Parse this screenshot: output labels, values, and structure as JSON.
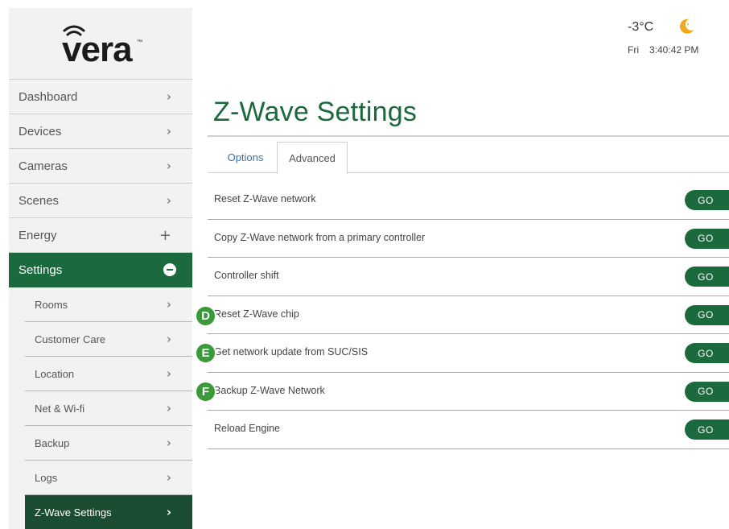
{
  "logo": {
    "text": "vera"
  },
  "sidebar": {
    "items": [
      {
        "label": "Dashboard",
        "icon": "chevron-right-icon",
        "glyph": "›"
      },
      {
        "label": "Devices",
        "icon": "chevron-right-icon",
        "glyph": "›"
      },
      {
        "label": "Cameras",
        "icon": "chevron-right-icon",
        "glyph": "›"
      },
      {
        "label": "Scenes",
        "icon": "chevron-right-icon",
        "glyph": "›"
      },
      {
        "label": "Energy",
        "icon": "plus-icon",
        "glyph": "+"
      },
      {
        "label": "Settings",
        "icon": "minus-icon",
        "expanded": true
      }
    ],
    "subitems": [
      {
        "label": "Rooms",
        "glyph": "›"
      },
      {
        "label": "Customer Care",
        "glyph": "›"
      },
      {
        "label": "Location",
        "glyph": "›"
      },
      {
        "label": "Net & Wi-fi",
        "glyph": "›"
      },
      {
        "label": "Backup",
        "glyph": "›"
      },
      {
        "label": "Logs",
        "glyph": "›"
      },
      {
        "label": "Z-Wave Settings",
        "glyph": "›",
        "active": true
      }
    ]
  },
  "header": {
    "temperature": "-3°C",
    "weather_icon": "moon-icon",
    "day": "Fri",
    "time": "3:40:42 PM"
  },
  "main": {
    "title": "Z-Wave Settings",
    "tabs": [
      {
        "label": "Options",
        "active": false
      },
      {
        "label": "Advanced",
        "active": true
      }
    ],
    "rows": [
      {
        "label": "Reset Z-Wave network",
        "button": "GO"
      },
      {
        "label": "Copy Z-Wave network from a primary controller",
        "button": "GO"
      },
      {
        "label": "Controller shift",
        "button": "GO"
      },
      {
        "label": "Reset Z-Wave chip",
        "button": "GO"
      },
      {
        "label": "Get network update from SUC/SIS",
        "button": "GO"
      },
      {
        "label": "Backup Z-Wave Network",
        "button": "GO"
      },
      {
        "label": "Reload Engine",
        "button": "GO"
      }
    ]
  },
  "markers": [
    "D",
    "E",
    "F"
  ],
  "colors": {
    "brand_green": "#1b6a3e",
    "active_dark_green": "#1b4d33",
    "marker_green": "#3a9a3a",
    "moon_yellow": "#f0a81c",
    "tab_link_blue": "#3a6fb0"
  }
}
